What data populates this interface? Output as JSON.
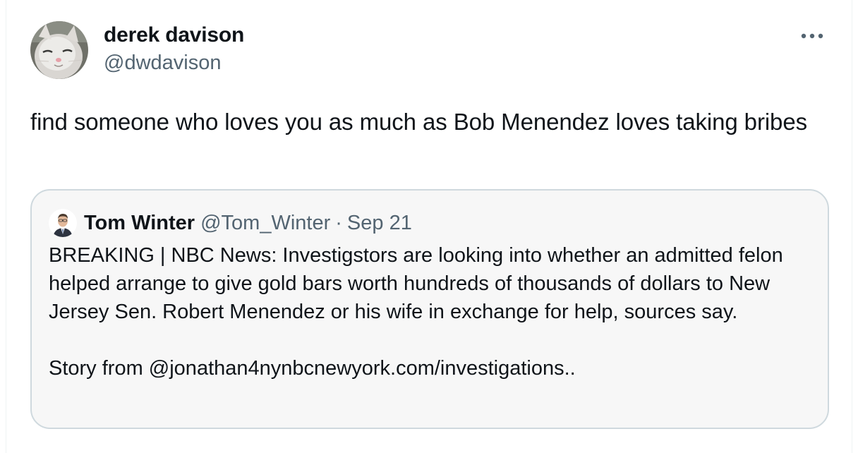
{
  "tweet": {
    "author": {
      "display_name": "derek davison",
      "handle": "@dwdavison",
      "avatar_icon": "cat-avatar"
    },
    "more_icon": "more-horizontal-icon",
    "text": "find someone who loves you as much as Bob Menendez loves taking bribes"
  },
  "quote": {
    "author": {
      "display_name": "Tom Winter",
      "handle": "@Tom_Winter",
      "avatar_icon": "person-avatar"
    },
    "separator": "·",
    "date": "Sep 21",
    "paragraph_1": "BREAKING | NBC News: Investigstors are looking into whether an admitted felon helped arrange to give gold bars worth hundreds of thousands of dollars to New Jersey Sen. Robert Menendez or his wife in exchange for help, sources say.",
    "paragraph_2": "Story from @jonathan4nynbcnewyork.com/investigations.."
  },
  "colors": {
    "text_primary": "#0f1419",
    "text_secondary": "#536471",
    "quote_background": "#f7f7f7",
    "quote_border": "#cfd9de"
  }
}
